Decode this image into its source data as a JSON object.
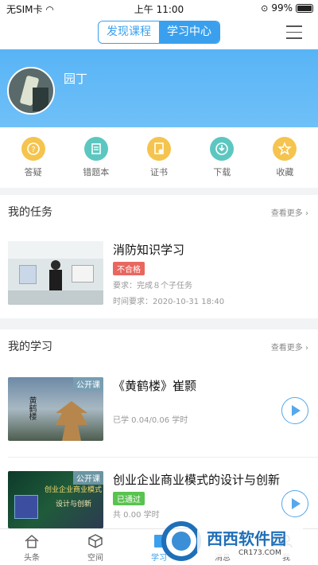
{
  "status": {
    "carrier": "无SIM卡",
    "time": "上午 11:00",
    "battery": "99%"
  },
  "nav": {
    "tabs": [
      "发现课程",
      "学习中心"
    ],
    "active": 1
  },
  "profile": {
    "name": "园丁"
  },
  "actions": [
    {
      "label": "答疑",
      "icon": "question-icon"
    },
    {
      "label": "错题本",
      "icon": "notebook-icon"
    },
    {
      "label": "证书",
      "icon": "certificate-icon"
    },
    {
      "label": "下载",
      "icon": "download-icon"
    },
    {
      "label": "收藏",
      "icon": "star-icon"
    }
  ],
  "tasks": {
    "title": "我的任务",
    "more": "查看更多 ›",
    "item": {
      "title": "消防知识学习",
      "tag": "不合格",
      "req": "要求：完成８个子任务",
      "time": "时间要求：2020-10-31 18:40"
    }
  },
  "study": {
    "title": "我的学习",
    "more": "查看更多 ›",
    "items": [
      {
        "badge": "公开课",
        "title": "《黄鹤楼》崔颢",
        "progress": "已学 0.04/0.06 学时",
        "thumb_text": "黄鹤楼"
      },
      {
        "badge": "公开课",
        "title": "创业企业商业模式的设计与创新",
        "tag": "已通过",
        "hours": "共 0.00 学时",
        "thumb_text1": "创业企业商业模式",
        "thumb_text2": "设计与创新"
      }
    ]
  },
  "tabbar": [
    {
      "label": "头条",
      "icon": "home-icon"
    },
    {
      "label": "空间",
      "icon": "cube-icon"
    },
    {
      "label": "学习",
      "icon": "book-icon"
    },
    {
      "label": "消息",
      "icon": "message-icon"
    },
    {
      "label": "我",
      "icon": "person-icon"
    }
  ],
  "watermark": {
    "brand": "西西软件园",
    "url": "CR173.COM"
  }
}
